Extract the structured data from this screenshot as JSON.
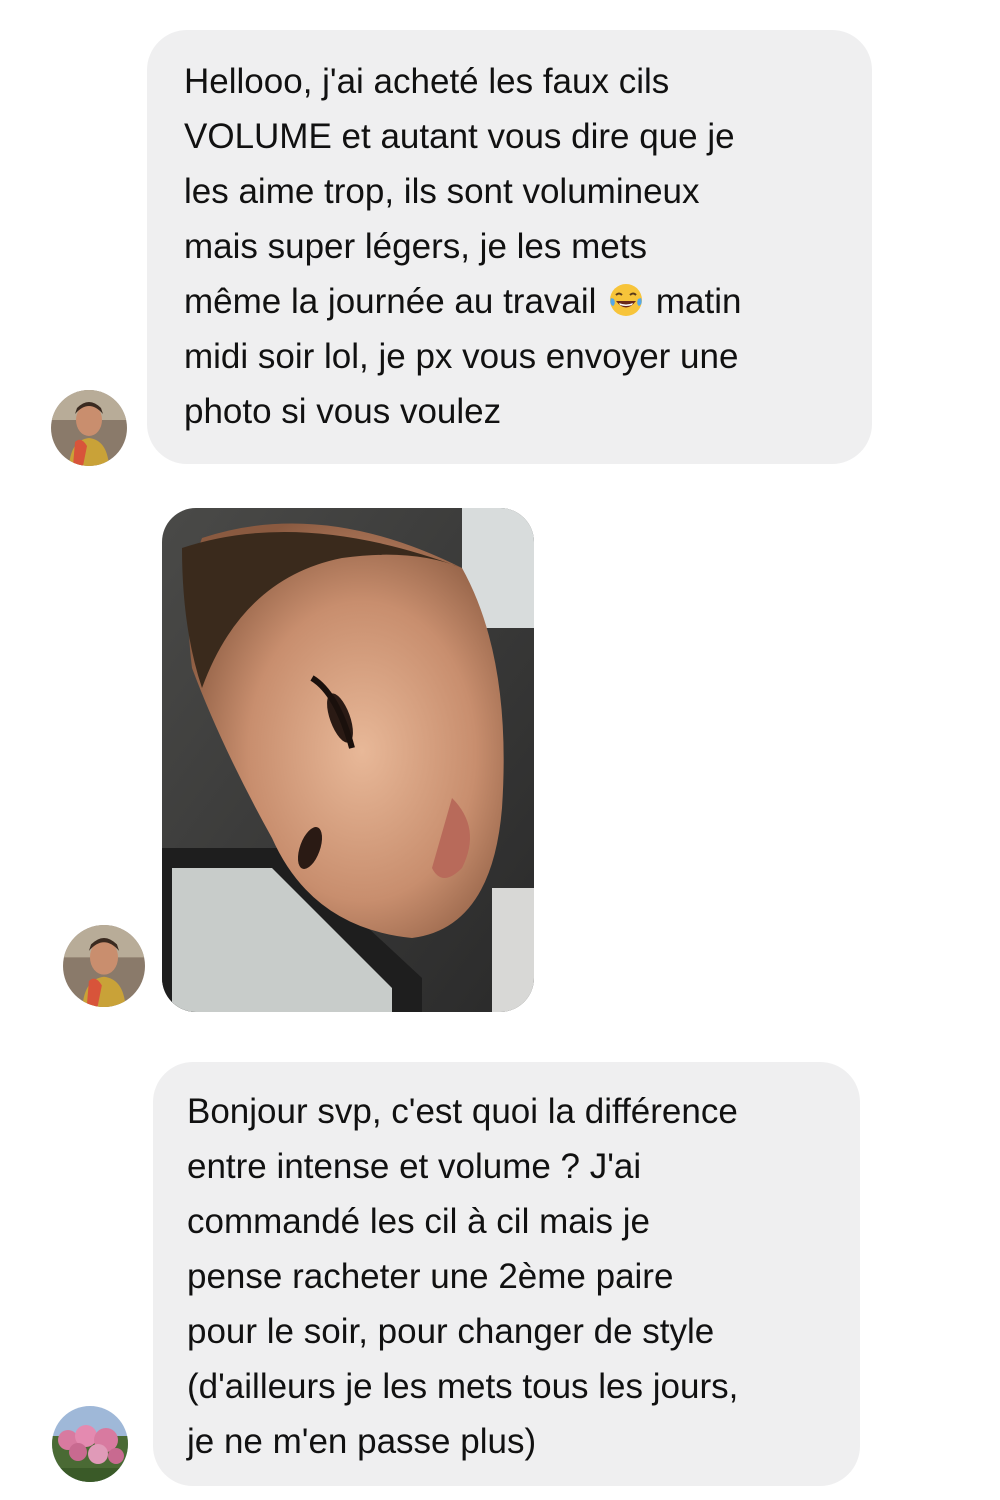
{
  "conversation": {
    "messages": [
      {
        "sender": "customer-1",
        "lines": [
          "Hellooo, j'ai acheté les faux cils",
          "VOLUME et autant vous dire que je",
          "les aime trop, ils sont volumineux",
          "mais super légers, je les mets",
          {
            "before": "même la journée au travail ",
            "emoji": "face-with-tears-of-joy-icon",
            "after": " matin"
          },
          "midi soir lol, je px vous envoyer une",
          "photo si vous voulez"
        ]
      },
      {
        "sender": "customer-1",
        "attachment": {
          "type": "image",
          "icon": "selfie-photo"
        }
      },
      {
        "sender": "customer-2",
        "lines": [
          "Bonjour svp, c'est quoi la différence",
          "entre intense et volume ? J'ai",
          "commandé les cil à cil mais je",
          "pense racheter une 2ème paire",
          "pour le soir, pour changer de style",
          "(d'ailleurs je les mets tous les jours,",
          "je ne m'en passe plus)"
        ]
      }
    ]
  },
  "colors": {
    "bubble_background": "#efeff0",
    "text": "#111111",
    "page_background": "#ffffff"
  }
}
